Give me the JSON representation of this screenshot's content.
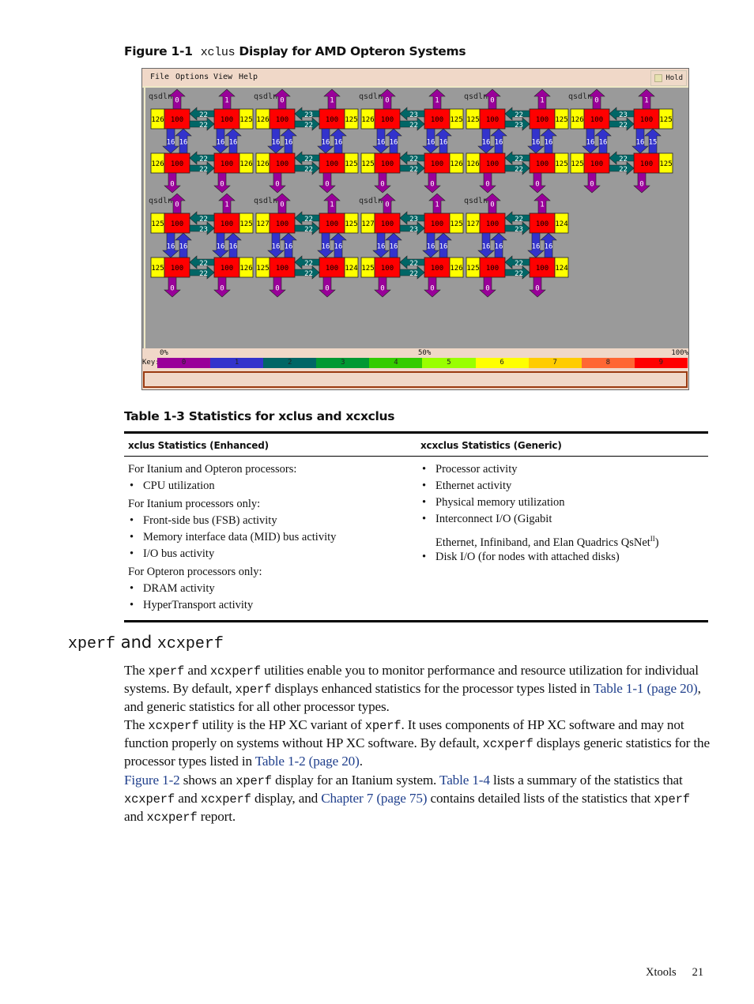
{
  "figure": {
    "label": "Figure  1-1",
    "command": "xclus",
    "title": "Display for AMD Opteron Systems"
  },
  "app": {
    "menu": [
      "File",
      "Options",
      "View",
      "Help"
    ],
    "hold_label": "Hold",
    "hold_checked": false,
    "legend": {
      "pct_left": "0%",
      "pct_mid": "50%",
      "pct_right": "100%",
      "key_label": "Key:",
      "keys": [
        {
          "label": "0",
          "color": "#990099"
        },
        {
          "label": "1",
          "color": "#3333cc"
        },
        {
          "label": "2",
          "color": "#006666"
        },
        {
          "label": "3",
          "color": "#009933"
        },
        {
          "label": "4",
          "color": "#33cc00"
        },
        {
          "label": "5",
          "color": "#99ff00"
        },
        {
          "label": "6",
          "color": "#ffff00"
        },
        {
          "label": "7",
          "color": "#ffcc00"
        },
        {
          "label": "8",
          "color": "#ff6633"
        },
        {
          "label": "9",
          "color": "#ff0000"
        }
      ]
    },
    "status_text": "",
    "clusters": [
      {
        "name": "qsdln7",
        "top": {
          "l_mem": "126",
          "l_cpu": "100",
          "r_cpu": "100",
          "r_mem": "125",
          "link_rl": "22",
          "link_lr": "22",
          "l_io": "0",
          "r_io": "1"
        },
        "vert": [
          "16",
          "16",
          "16",
          "16"
        ],
        "bottom": {
          "l_mem": "126",
          "l_cpu": "100",
          "r_cpu": "100",
          "r_mem": "126",
          "link_rl": "22",
          "link_lr": "22",
          "l_io": "0",
          "r_io": "0"
        }
      },
      {
        "name": "qsdln9",
        "top": {
          "l_mem": "126",
          "l_cpu": "100",
          "r_cpu": "100",
          "r_mem": "125",
          "link_rl": "23",
          "link_lr": "22",
          "l_io": "0",
          "r_io": "1"
        },
        "vert": [
          "16",
          "16",
          "16",
          "16"
        ],
        "bottom": {
          "l_mem": "126",
          "l_cpu": "100",
          "r_cpu": "100",
          "r_mem": "125",
          "link_rl": "22",
          "link_lr": "22",
          "l_io": "0",
          "r_io": "0"
        }
      },
      {
        "name": "qsdln10",
        "top": {
          "l_mem": "126",
          "l_cpu": "100",
          "r_cpu": "100",
          "r_mem": "125",
          "link_rl": "23",
          "link_lr": "22",
          "l_io": "0",
          "r_io": "1"
        },
        "vert": [
          "16",
          "16",
          "16",
          "16"
        ],
        "bottom": {
          "l_mem": "125",
          "l_cpu": "100",
          "r_cpu": "100",
          "r_mem": "126",
          "link_rl": "22",
          "link_lr": "22",
          "l_io": "0",
          "r_io": "0"
        }
      },
      {
        "name": "qsdln11",
        "top": {
          "l_mem": "125",
          "l_cpu": "100",
          "r_cpu": "100",
          "r_mem": "125",
          "link_rl": "22",
          "link_lr": "23",
          "l_io": "0",
          "r_io": "1"
        },
        "vert": [
          "16",
          "16",
          "16",
          "16"
        ],
        "bottom": {
          "l_mem": "126",
          "l_cpu": "100",
          "r_cpu": "100",
          "r_mem": "125",
          "link_rl": "22",
          "link_lr": "22",
          "l_io": "0",
          "r_io": "0"
        }
      },
      {
        "name": "qsdln12",
        "top": {
          "l_mem": "126",
          "l_cpu": "100",
          "r_cpu": "100",
          "r_mem": "125",
          "link_rl": "23",
          "link_lr": "22",
          "l_io": "0",
          "r_io": "1"
        },
        "vert": [
          "16",
          "16",
          "16",
          "15"
        ],
        "bottom": {
          "l_mem": "125",
          "l_cpu": "100",
          "r_cpu": "100",
          "r_mem": "125",
          "link_rl": "22",
          "link_lr": "22",
          "l_io": "0",
          "r_io": "0"
        }
      },
      {
        "name": "qsdln14",
        "top": {
          "l_mem": "125",
          "l_cpu": "100",
          "r_cpu": "100",
          "r_mem": "125",
          "link_rl": "22",
          "link_lr": "23",
          "l_io": "0",
          "r_io": "1"
        },
        "vert": [
          "16",
          "16",
          "16",
          "16"
        ],
        "bottom": {
          "l_mem": "125",
          "l_cpu": "100",
          "r_cpu": "100",
          "r_mem": "126",
          "link_rl": "22",
          "link_lr": "22",
          "l_io": "0",
          "r_io": "0"
        }
      },
      {
        "name": "qsdln15",
        "top": {
          "l_mem": "127",
          "l_cpu": "100",
          "r_cpu": "100",
          "r_mem": "125",
          "link_rl": "22",
          "link_lr": "22",
          "l_io": "0",
          "r_io": "1"
        },
        "vert": [
          "16",
          "16",
          "16",
          "16"
        ],
        "bottom": {
          "l_mem": "125",
          "l_cpu": "100",
          "r_cpu": "100",
          "r_mem": "124",
          "link_rl": "22",
          "link_lr": "22",
          "l_io": "0",
          "r_io": "0"
        }
      },
      {
        "name": "qsdln16",
        "top": {
          "l_mem": "127",
          "l_cpu": "100",
          "r_cpu": "100",
          "r_mem": "125",
          "link_rl": "23",
          "link_lr": "23",
          "l_io": "0",
          "r_io": "1"
        },
        "vert": [
          "16",
          "16",
          "16",
          "16"
        ],
        "bottom": {
          "l_mem": "125",
          "l_cpu": "100",
          "r_cpu": "100",
          "r_mem": "126",
          "link_rl": "22",
          "link_lr": "22",
          "l_io": "0",
          "r_io": "0"
        }
      },
      {
        "name": "qsdln17",
        "top": {
          "l_mem": "127",
          "l_cpu": "100",
          "r_cpu": "100",
          "r_mem": "124",
          "link_rl": "22",
          "link_lr": "23",
          "l_io": "0",
          "r_io": "1"
        },
        "vert": [
          "16",
          "16",
          "16",
          "16"
        ],
        "bottom": {
          "l_mem": "125",
          "l_cpu": "100",
          "r_cpu": "100",
          "r_mem": "124",
          "link_rl": "22",
          "link_lr": "22",
          "l_io": "0",
          "r_io": "0"
        }
      }
    ],
    "colors": {
      "cpu": "#ff0000",
      "mem": "#ffff00",
      "io": "#990099",
      "vert": "#3333cc",
      "link": "#006666",
      "bg": "#9a9a9a"
    }
  },
  "table": {
    "label": "Table  1-3",
    "title": "Statistics for xclus and xcxclus",
    "headers": [
      "xclus Statistics (Enhanced)",
      "xcxclus Statistics (Generic)"
    ],
    "col1": [
      {
        "type": "text",
        "text": "For Itanium and Opteron processors:"
      },
      {
        "type": "bullet",
        "text": "CPU utilization"
      },
      {
        "type": "text",
        "text": "For Itanium processors only:"
      },
      {
        "type": "bullet",
        "text": "Front-side bus (FSB) activity"
      },
      {
        "type": "bullet",
        "text": "Memory interface data (MID) bus activity"
      },
      {
        "type": "bullet",
        "text": "I/O bus activity"
      },
      {
        "type": "text",
        "text": "For Opteron processors only:"
      },
      {
        "type": "bullet",
        "text": "DRAM activity"
      },
      {
        "type": "bullet",
        "text": "HyperTransport activity"
      }
    ],
    "col2": [
      {
        "type": "bullet",
        "text": "Processor activity"
      },
      {
        "type": "bullet",
        "text": "Ethernet activity"
      },
      {
        "type": "bullet",
        "text": "Physical memory utilization"
      },
      {
        "type": "bullet",
        "text": "Interconnect I/O (Gigabit"
      },
      {
        "type": "cont",
        "text": "Ethernet, Infiniband, and Elan Quadrics QsNet",
        "sup": "II",
        "after": ")"
      },
      {
        "type": "bullet",
        "text": "Disk I/O (for nodes with attached disks)"
      }
    ]
  },
  "section": {
    "cmd1": "xperf",
    "and": "and",
    "cmd2": "xcxperf"
  },
  "paragraphs": {
    "p1": {
      "a": "The ",
      "b": "xperf",
      "c": " and ",
      "d": "xcxperf",
      "e": " utilities enable you to monitor performance and resource utilization for individual systems. By default, ",
      "f": "xperf",
      "g": " displays enhanced statistics for the processor types listed in ",
      "link": "Table 1-1 (page 20)",
      "h": ", and generic statistics for all other processor types."
    },
    "p2": {
      "a": "The ",
      "b": "xcxperf",
      "c": " utility is the HP XC variant of ",
      "d": "xperf",
      "e": ". It uses components of HP XC software and may not function properly on systems without HP XC software. By default, ",
      "f": "xcxperf",
      "g": " displays generic statistics for the processor types listed in ",
      "link": "Table 1-2 (page 20)",
      "h": "."
    },
    "p3": {
      "link1": "Figure 1-2",
      "a": " shows an ",
      "b": "xperf",
      "c": " display for an Itanium system. ",
      "link2": "Table 1-4",
      "d": " lists a summary of the statistics that ",
      "e": "xcxperf",
      "f": " and ",
      "g": "xcxperf",
      "h": " display, and ",
      "link3": "Chapter 7 (page 75)",
      "i": " contains detailed lists of the statistics that ",
      "j": "xperf",
      "k": " and ",
      "l": "xcxperf",
      "m": " report."
    }
  },
  "footer": {
    "section": "Xtools",
    "page": "21"
  }
}
